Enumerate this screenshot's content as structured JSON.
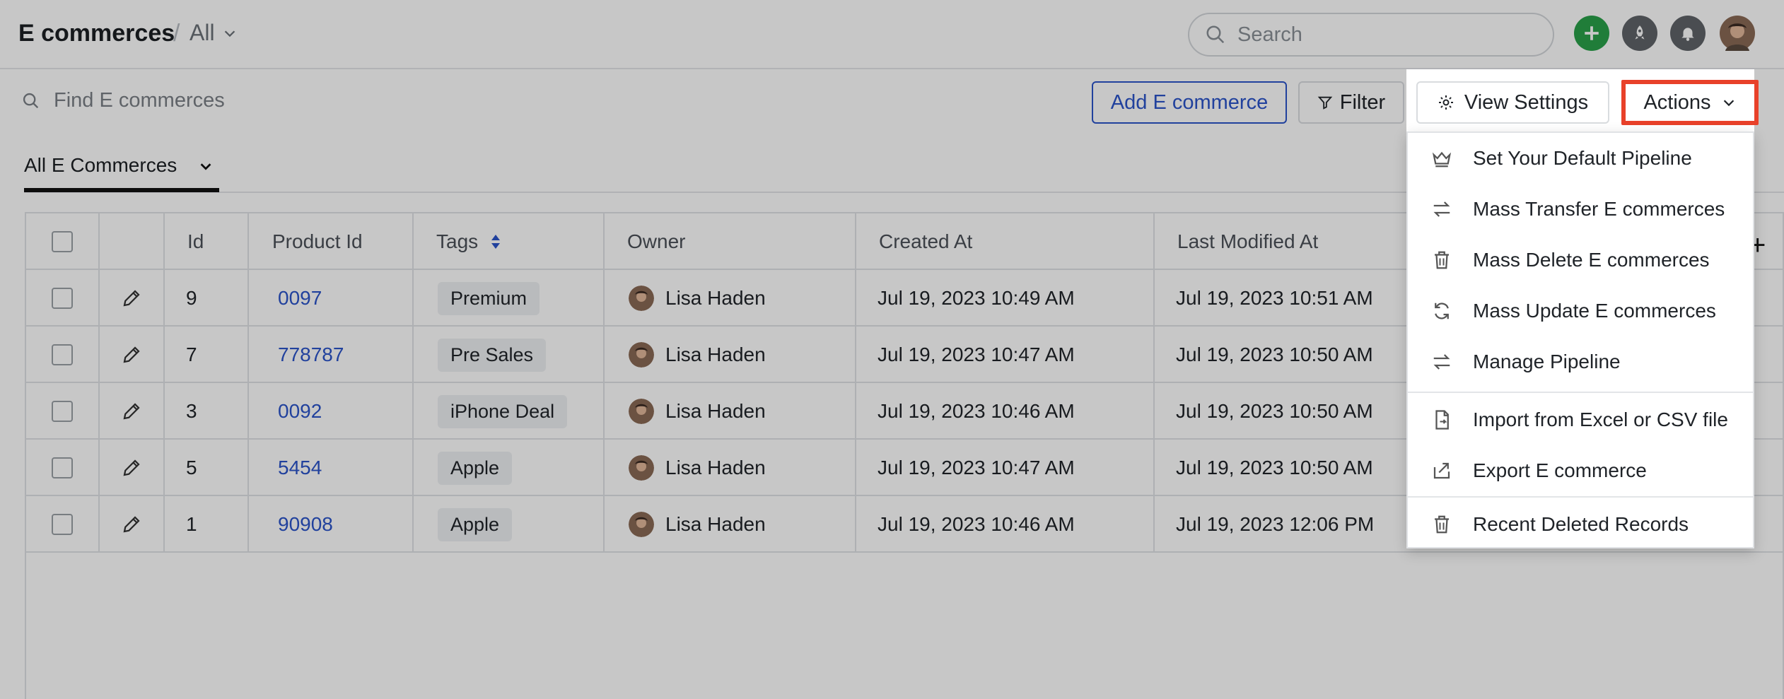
{
  "header": {
    "title": "E commerces",
    "separator": "/",
    "view_label": "All",
    "search_placeholder": "Search"
  },
  "toolbar": {
    "find_placeholder": "Find E commerces",
    "add_label": "Add E commerce",
    "filter_label": "Filter",
    "view_settings_label": "View Settings",
    "actions_label": "Actions"
  },
  "tabs": {
    "active_label": "All E Commerces"
  },
  "table": {
    "columns": [
      "Id",
      "Product Id",
      "Tags",
      "Owner",
      "Created At",
      "Last Modified At"
    ],
    "add_column": "+",
    "rows": [
      {
        "id": "9",
        "product_id": "0097",
        "tag": "Premium",
        "owner": "Lisa Haden",
        "created": "Jul 19, 2023 10:49 AM",
        "modified": "Jul 19, 2023 10:51 AM"
      },
      {
        "id": "7",
        "product_id": "778787",
        "tag": "Pre Sales",
        "owner": "Lisa Haden",
        "created": "Jul 19, 2023 10:47 AM",
        "modified": "Jul 19, 2023 10:50 AM"
      },
      {
        "id": "3",
        "product_id": "0092",
        "tag": "iPhone Deal",
        "owner": "Lisa Haden",
        "created": "Jul 19, 2023 10:46 AM",
        "modified": "Jul 19, 2023 10:50 AM"
      },
      {
        "id": "5",
        "product_id": "5454",
        "tag": "Apple",
        "owner": "Lisa Haden",
        "created": "Jul 19, 2023 10:47 AM",
        "modified": "Jul 19, 2023 10:50 AM"
      },
      {
        "id": "1",
        "product_id": "90908",
        "tag": "Apple",
        "owner": "Lisa Haden",
        "created": "Jul 19, 2023 10:46 AM",
        "modified": "Jul 19, 2023 12:06 PM"
      }
    ]
  },
  "actions_menu": {
    "items": [
      {
        "label": "Set Your Default Pipeline",
        "icon": "crown-icon"
      },
      {
        "label": "Mass Transfer E commerces",
        "icon": "transfer-icon"
      },
      {
        "label": "Mass Delete E commerces",
        "icon": "trash-icon"
      },
      {
        "label": "Mass Update E commerces",
        "icon": "refresh-icon"
      },
      {
        "label": "Manage Pipeline",
        "icon": "transfer-icon"
      },
      {
        "label": "Import from Excel or CSV file",
        "icon": "file-import-icon"
      },
      {
        "label": "Export E commerce",
        "icon": "export-icon"
      },
      {
        "label": "Recent Deleted Records",
        "icon": "trash-icon"
      }
    ]
  },
  "colors": {
    "accent_blue": "#2b54c9",
    "highlight_red": "#e8412a",
    "add_green": "#2aa04a"
  }
}
